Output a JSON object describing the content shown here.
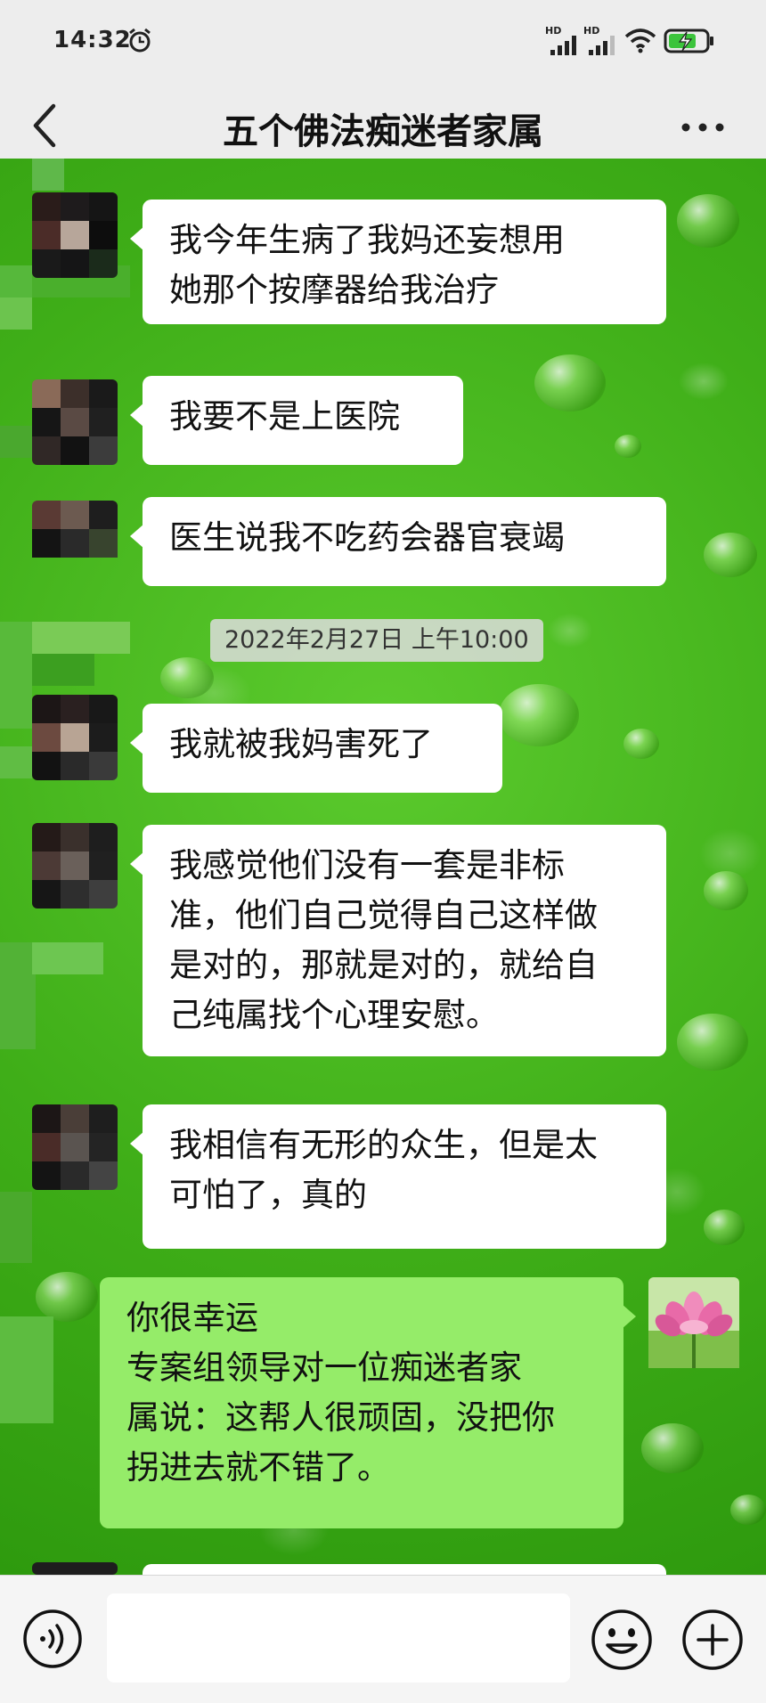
{
  "status_bar": {
    "time": "14:32",
    "network_1": "HD",
    "network_2": "HD",
    "icons": [
      "alarm-icon",
      "signal-icon",
      "signal-icon",
      "wifi-icon",
      "battery-charging-icon"
    ]
  },
  "header": {
    "title": "五个佛法痴迷者家属",
    "back_icon": "chevron-left-icon",
    "more_icon": "more-dots-icon"
  },
  "messages": [
    {
      "side": "in",
      "text": "我今年生病了我妈还妄想用\n她那个按摩器给我治疗"
    },
    {
      "side": "in",
      "text": "我要不是上医院"
    },
    {
      "side": "in",
      "text": "医生说我不吃药会器官衰竭"
    },
    {
      "side": "in",
      "text": "我就被我妈害死了"
    },
    {
      "side": "in",
      "text": "我感觉他们没有一套是非标\n准，他们自己觉得自己这样做\n是对的，那就是对的，就给自\n己纯属找个心理安慰。"
    },
    {
      "side": "in",
      "text": "我相信有无形的众生，但是太\n可怕了，真的"
    },
    {
      "side": "out",
      "text": "你很幸运\n专案组领导对一位痴迷者家\n属说：这帮人很顽固，没把你\n拐进去就不错了。"
    }
  ],
  "timestamp": "2022年2月27日 上午10:00",
  "input_bar": {
    "placeholder": "",
    "icons": [
      "voice-icon",
      "emoji-icon",
      "plus-icon"
    ]
  },
  "colors": {
    "header_bg": "#ededed",
    "incoming_bubble": "#ffffff",
    "outgoing_bubble": "#95ec69",
    "chat_background": "#3fae18"
  }
}
